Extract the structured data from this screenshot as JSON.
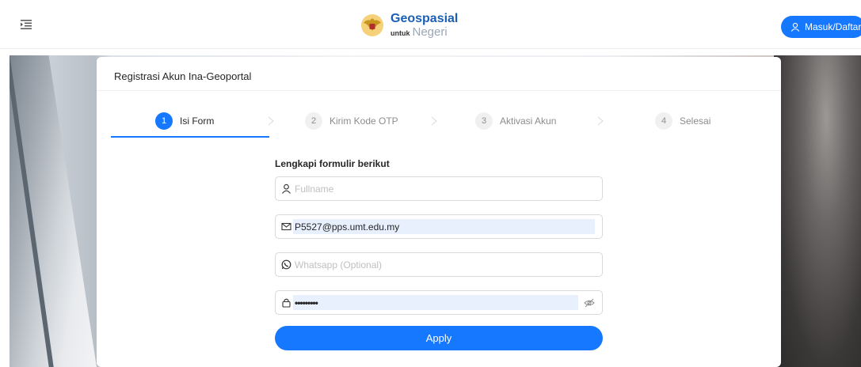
{
  "header": {
    "brand_title": "Geospasial",
    "brand_small": "untuk",
    "brand_sub": "Negeri",
    "login_label": "Masuk/Daftar"
  },
  "card": {
    "title": "Registrasi Akun Ina-Geoportal"
  },
  "steps": [
    {
      "num": "1",
      "label": "Isi Form",
      "active": true
    },
    {
      "num": "2",
      "label": "Kirim Kode OTP",
      "active": false
    },
    {
      "num": "3",
      "label": "Aktivasi Akun",
      "active": false
    },
    {
      "num": "4",
      "label": "Selesai",
      "active": false
    }
  ],
  "form": {
    "title": "Lengkapi formulir berikut",
    "fullname": {
      "placeholder": "Fullname",
      "value": ""
    },
    "email": {
      "placeholder": "Email",
      "value": "P5527@pps.umt.edu.my"
    },
    "whatsapp": {
      "placeholder": "Whatsapp (Optional)",
      "value": ""
    },
    "password": {
      "placeholder": "Password",
      "value": "•••••••••"
    },
    "apply_label": "Apply"
  },
  "colors": {
    "accent": "#1677ff",
    "brand": "#1a5fb4",
    "autofill_bg": "#e8f0fe"
  },
  "icons": {
    "menu": "menu-fold-icon",
    "login": "user-icon",
    "fullname": "user-icon",
    "email": "mail-icon",
    "whatsapp": "whatsapp-icon",
    "password": "lock-icon",
    "visibility": "eye-invisible-icon"
  }
}
